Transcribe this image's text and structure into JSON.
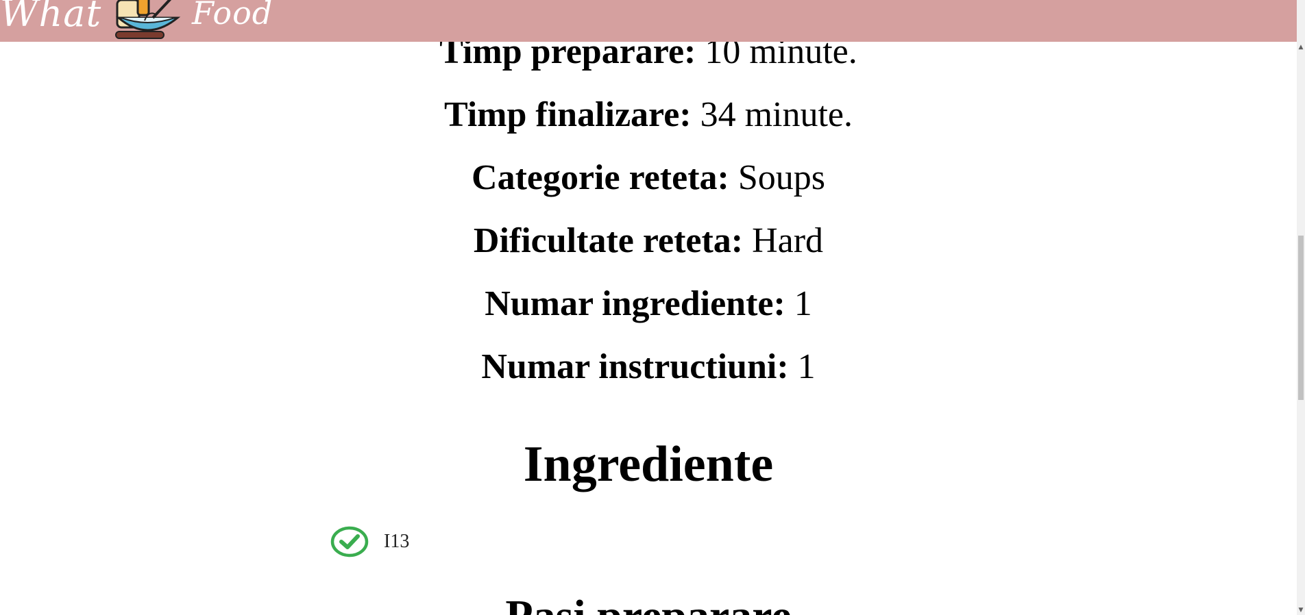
{
  "header": {
    "logo_word_left": "What",
    "logo_word_right": "Food",
    "background_color": "#d5a09f"
  },
  "recipe_info": [
    {
      "label": "Timp preparare:",
      "value": " 10 minute."
    },
    {
      "label": "Timp finalizare:",
      "value": " 34 minute."
    },
    {
      "label": "Categorie reteta:",
      "value": " Soups"
    },
    {
      "label": "Dificultate reteta:",
      "value": " Hard"
    },
    {
      "label": "Numar ingrediente:",
      "value": " 1"
    },
    {
      "label": "Numar instructiuni:",
      "value": " 1"
    }
  ],
  "ingredients_section": {
    "heading": "Ingrediente",
    "items": [
      {
        "name": "I13",
        "icon": "check-circle-icon",
        "icon_color": "#3aad4f"
      }
    ]
  },
  "steps_section": {
    "heading": "Pasi preparare"
  },
  "scrollbar": {
    "up_arrow": "▲",
    "down_arrow": "▼"
  }
}
